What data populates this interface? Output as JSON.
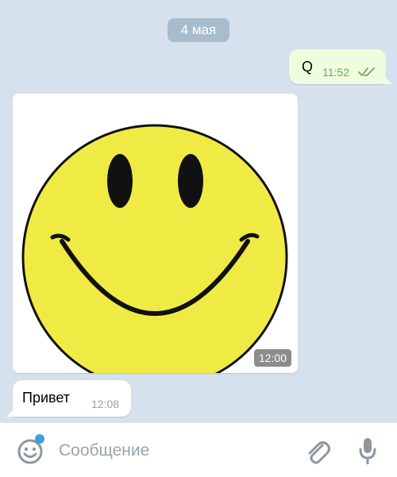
{
  "chat": {
    "date_separator": "4 мая",
    "outgoing": {
      "text": "Q",
      "time": "11:52",
      "status_icon": "double-check-icon"
    },
    "image_message": {
      "time": "12:00",
      "image_subject": "yellow smiley face"
    },
    "incoming": {
      "text": "Привет",
      "time": "12:08"
    }
  },
  "input_bar": {
    "placeholder": "Сообщение",
    "value": "",
    "emoji_icon": "emoji-smile-icon",
    "attach_icon": "paperclip-icon",
    "mic_icon": "microphone-icon",
    "notification_dot_color": "#3f9fe4"
  },
  "colors": {
    "chat_background": "#d5e1ec",
    "outgoing_bubble": "#effdde",
    "read_check": "#6aa85f",
    "smiley_yellow": "#f0ea45"
  }
}
